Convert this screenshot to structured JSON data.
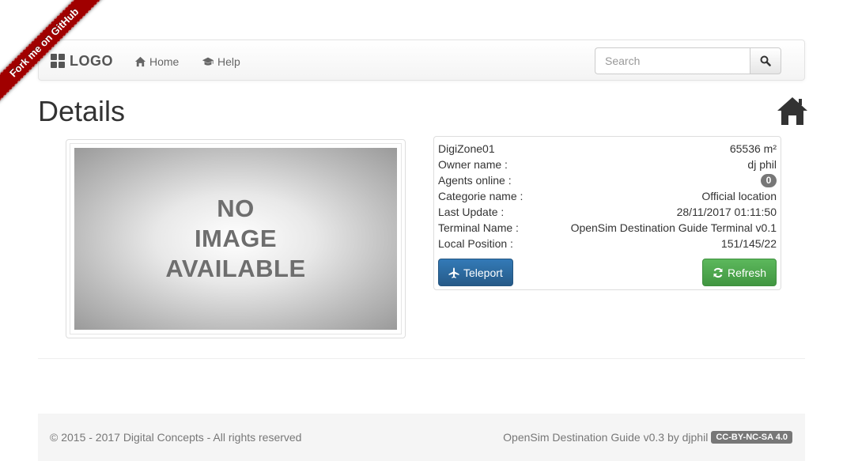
{
  "ribbon": {
    "label": "Fork me on GitHub"
  },
  "navbar": {
    "brand": "LOGO",
    "home_label": "Home",
    "help_label": "Help",
    "search_placeholder": "Search"
  },
  "page": {
    "title": "Details"
  },
  "image": {
    "line1": "NO",
    "line2": "IMAGE",
    "line3": "AVAILABLE"
  },
  "details": {
    "region_name": "DigiZone01",
    "region_size": "65536 m²",
    "rows": [
      {
        "label": "Owner name :",
        "value": "dj phil"
      },
      {
        "label": "Agents online :",
        "value": "0"
      },
      {
        "label": "Categorie name :",
        "value": "Official location"
      },
      {
        "label": "Last Update :",
        "value": "28/11/2017 01:11:50"
      },
      {
        "label": "Terminal Name :",
        "value": "OpenSim Destination Guide Terminal v0.1"
      },
      {
        "label": "Local Position :",
        "value": "151/145/22"
      }
    ],
    "teleport_label": "Teleport",
    "refresh_label": "Refresh"
  },
  "footer": {
    "copyright": "© 2015 - 2017 Digital Concepts - All rights reserved",
    "credits": "OpenSim Destination Guide v0.3 by djphil",
    "license": "CC-BY-NC-SA 4.0"
  },
  "colors": {
    "primary": "#337ab7",
    "success": "#5cb85c",
    "ribbon": "#a00000",
    "badge": "#777777"
  }
}
